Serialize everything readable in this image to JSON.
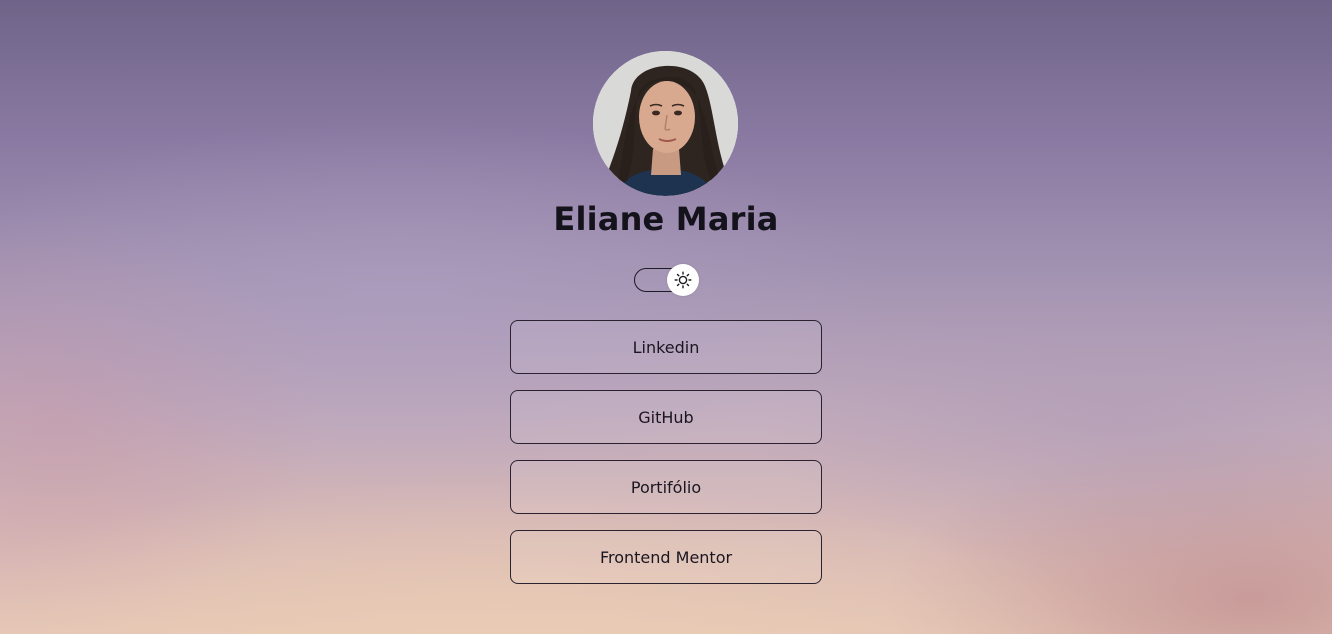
{
  "profile": {
    "name": "Eliane Maria",
    "avatar_icon": "profile-photo"
  },
  "theme_toggle": {
    "icon": "sun-icon",
    "state": "light"
  },
  "links": [
    {
      "label": "Linkedin"
    },
    {
      "label": "GitHub"
    },
    {
      "label": "Portifólio"
    },
    {
      "label": "Frontend Mentor"
    }
  ]
}
